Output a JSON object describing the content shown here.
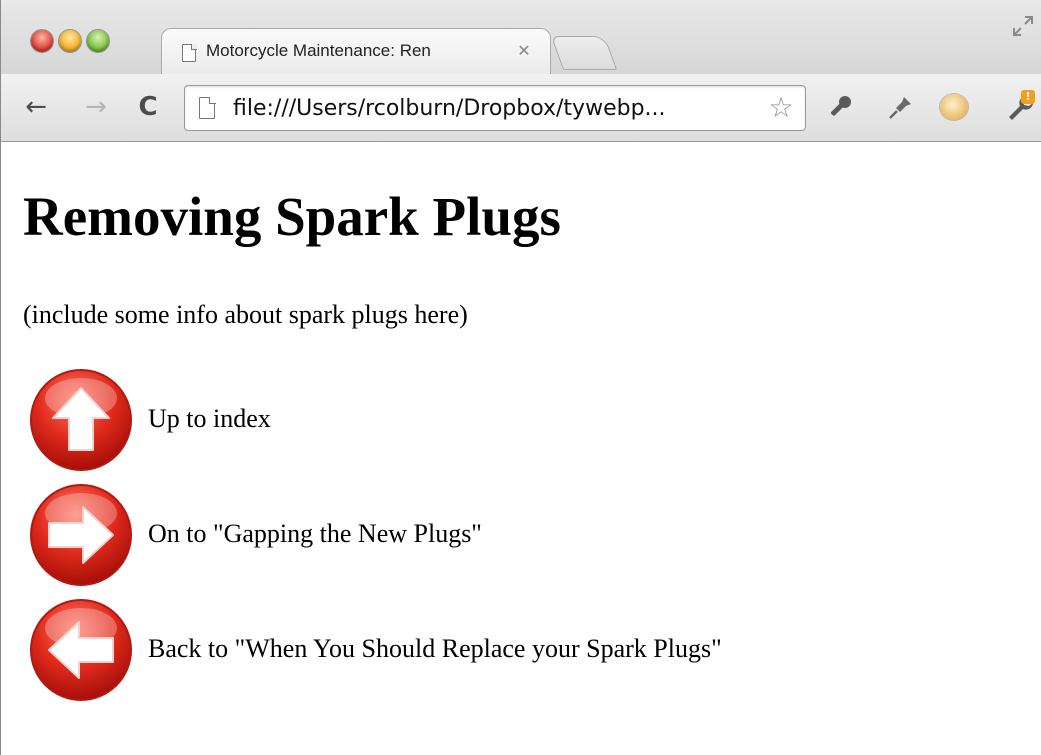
{
  "browser": {
    "tab": {
      "title": "Motorcycle Maintenance: Ren",
      "close_glyph": "✕"
    },
    "toolbar": {
      "back_glyph": "←",
      "forward_glyph": "→",
      "reload_glyph": "C",
      "url": "file:///Users/rcolburn/Dropbox/tywebp...",
      "star_glyph": "☆"
    },
    "icons": {
      "page": "page-icon",
      "star": "star-icon",
      "pen": "pen-extension-icon",
      "pin": "pin-extension-icon",
      "face": "face-extension-icon",
      "wrench": "wrench-menu-icon"
    },
    "colors": {
      "close": "#e0443a",
      "minimize": "#f0b12c",
      "maximize": "#7cc242",
      "arrow_red": "#d8231b"
    }
  },
  "page": {
    "heading": "Removing Spark Plugs",
    "intro": "(include some info about spark plugs here)",
    "links": [
      {
        "label": "Up to index",
        "icon": "up-arrow-icon"
      },
      {
        "label": "On to \"Gapping the New Plugs\"",
        "icon": "right-arrow-icon"
      },
      {
        "label": "Back to \"When You Should Replace your Spark Plugs\"",
        "icon": "left-arrow-icon"
      }
    ]
  }
}
